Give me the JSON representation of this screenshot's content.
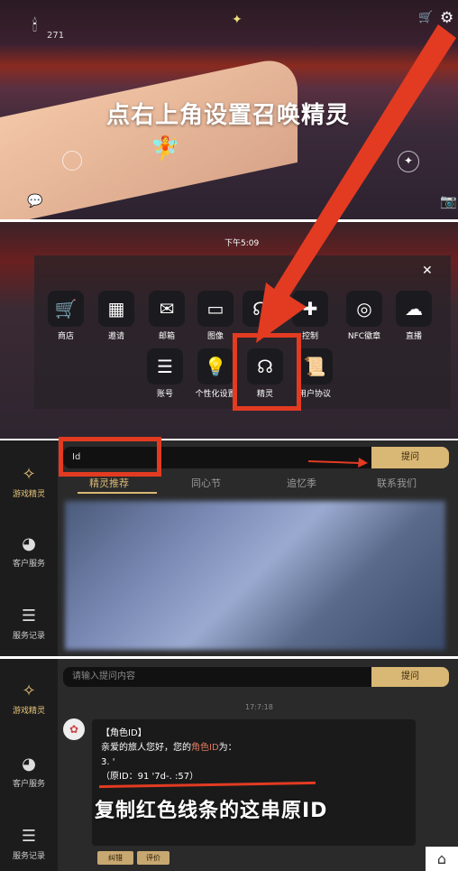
{
  "panel1": {
    "count": "271",
    "caption": "点右上角设置召唤精灵"
  },
  "panel2": {
    "time": "下午5:09",
    "close": "✕",
    "row1": [
      {
        "label": "商店",
        "icon": "cart-icon",
        "glyph": "🛒"
      },
      {
        "label": "邀请",
        "icon": "qr-icon",
        "glyph": "▦"
      },
      {
        "label": "邮箱",
        "icon": "mail-icon",
        "glyph": "✉"
      },
      {
        "label": "图像",
        "icon": "battery-icon",
        "glyph": "▭"
      },
      {
        "label": "",
        "icon": "headset-icon",
        "glyph": "☊"
      },
      {
        "label": "控制",
        "icon": "gamepad-icon",
        "glyph": "✚"
      },
      {
        "label": "NFC徽章",
        "icon": "nfc-icon",
        "glyph": "◎"
      },
      {
        "label": "直播",
        "icon": "live-icon",
        "glyph": "☁"
      }
    ],
    "row2": [
      {
        "label": "账号",
        "icon": "account-icon",
        "glyph": "☰"
      },
      {
        "label": "个性化设置",
        "icon": "bulb-icon",
        "glyph": "💡"
      },
      {
        "label": "精灵",
        "icon": "sprite-icon",
        "glyph": "☊"
      },
      {
        "label": "用户协议",
        "icon": "scroll-icon",
        "glyph": "📜"
      }
    ]
  },
  "panel3": {
    "search_value": "Id",
    "ask_label": "提问",
    "tabs": [
      "精灵推荐",
      "同心节",
      "追忆季",
      "联系我们"
    ],
    "sidebar": [
      {
        "label": "游戏精灵",
        "icon": "sprite-logo-icon"
      },
      {
        "label": "客户服务",
        "icon": "service-icon"
      },
      {
        "label": "服务记录",
        "icon": "record-icon"
      }
    ]
  },
  "panel4": {
    "search_placeholder": "请输入提问内容",
    "ask_label": "提问",
    "timestamp": "17:7:18",
    "chat": {
      "title": "【角色ID】",
      "line1": "亲爱的旅人您好，您的",
      "highlight": "角色ID",
      "line1_end": "为：",
      "line2": "3.              '",
      "line3": "（原ID：91                    '7d-.                      :57）"
    },
    "caption": "复制红色线条的这串原ID",
    "buttons": [
      "纠错",
      "评价"
    ],
    "sidebar": [
      {
        "label": "游戏精灵",
        "icon": "sprite-logo-icon"
      },
      {
        "label": "客户服务",
        "icon": "service-icon"
      },
      {
        "label": "服务记录",
        "icon": "record-icon"
      }
    ]
  },
  "colors": {
    "red": "#e23b22",
    "gold": "#d9b774",
    "highlight": "#e07a5f"
  }
}
